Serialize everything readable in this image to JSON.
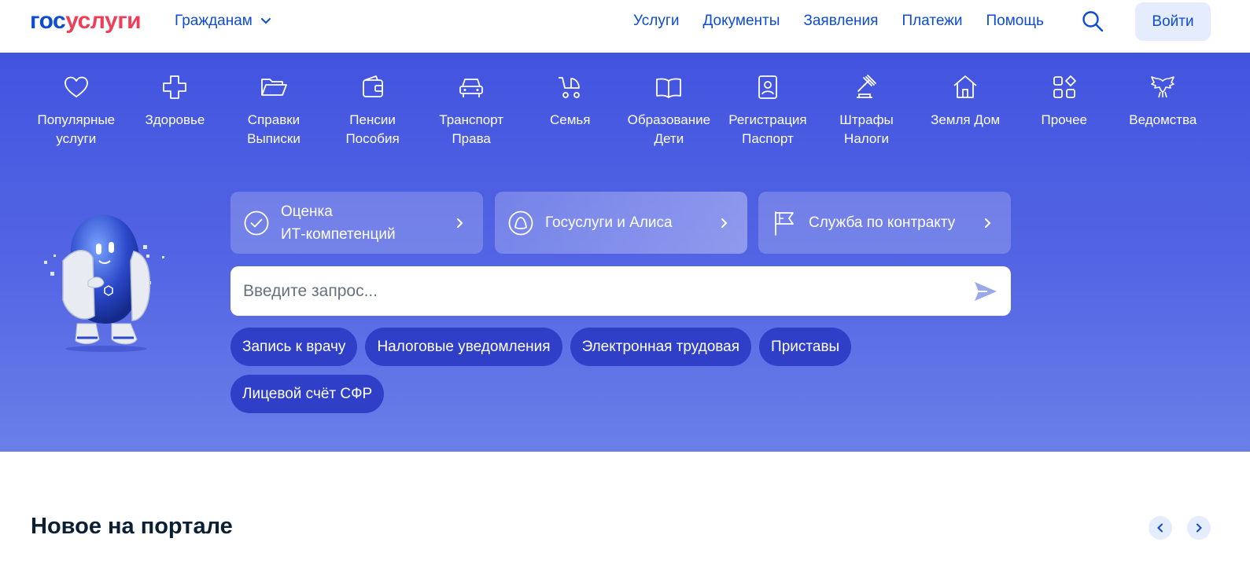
{
  "header": {
    "logo": {
      "part1": "гос",
      "part2": "услуги"
    },
    "audience": "Гражданам",
    "nav": [
      "Услуги",
      "Документы",
      "Заявления",
      "Платежи",
      "Помощь"
    ],
    "login": "Войти"
  },
  "categories": [
    {
      "line1": "Популярные",
      "line2": "услуги",
      "icon": "heart-icon"
    },
    {
      "line1": "Здоровье",
      "line2": "",
      "icon": "health-cross-icon"
    },
    {
      "line1": "Справки",
      "line2": "Выписки",
      "icon": "folder-icon"
    },
    {
      "line1": "Пенсии",
      "line2": "Пособия",
      "icon": "wallet-icon"
    },
    {
      "line1": "Транспорт",
      "line2": "Права",
      "icon": "car-icon"
    },
    {
      "line1": "Семья",
      "line2": "",
      "icon": "stroller-icon"
    },
    {
      "line1": "Образование",
      "line2": "Дети",
      "icon": "book-icon"
    },
    {
      "line1": "Регистрация",
      "line2": "Паспорт",
      "icon": "id-card-icon"
    },
    {
      "line1": "Штрафы",
      "line2": "Налоги",
      "icon": "gavel-icon"
    },
    {
      "line1": "Земля Дом",
      "line2": "",
      "icon": "house-icon"
    },
    {
      "line1": "Прочее",
      "line2": "",
      "icon": "grid-icon"
    },
    {
      "line1": "Ведомства",
      "line2": "",
      "icon": "eagle-icon"
    }
  ],
  "promos": [
    {
      "line1": "Оценка",
      "line2": "ИТ-компетенций",
      "icon": "check-circle-icon"
    },
    {
      "line1": "Госуслуги и Алиса",
      "line2": "",
      "icon": "alice-icon"
    },
    {
      "line1": "Служба по контракту",
      "line2": "",
      "icon": "flag-icon"
    }
  ],
  "search": {
    "placeholder": "Введите запрос..."
  },
  "chips": [
    "Запись к врачу",
    "Налоговые уведомления",
    "Электронная трудовая",
    "Приставы",
    "Лицевой счёт СФР"
  ],
  "section": {
    "title": "Новое на портале"
  },
  "colors": {
    "brand_blue": "#0d4cd3",
    "brand_red": "#ee3f58",
    "hero": "#4254df",
    "chip": "#2f3fc8"
  }
}
